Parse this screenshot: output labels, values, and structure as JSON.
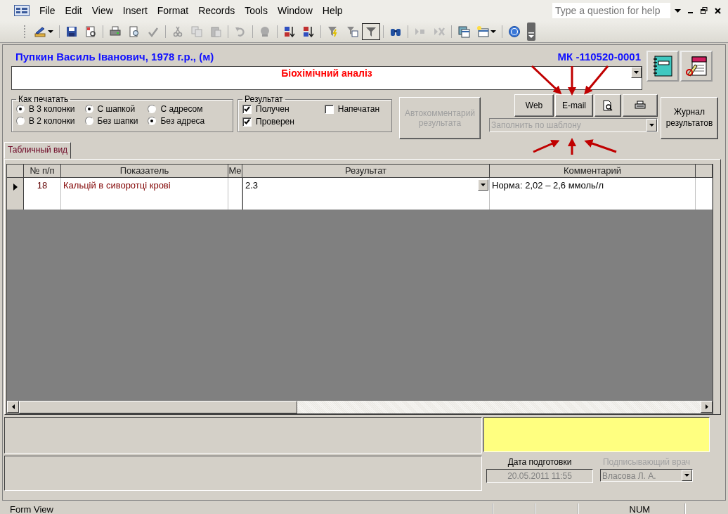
{
  "menubar": {
    "items": [
      "File",
      "Edit",
      "View",
      "Insert",
      "Format",
      "Records",
      "Tools",
      "Window",
      "Help"
    ],
    "help_search": {
      "placeholder": "Type a question for help"
    }
  },
  "form": {
    "patient": "Пупкин Василь Іванович, 1978 г.р., (м)",
    "record_id": "МК -110520-0001",
    "analysis": "Біохімічний аналіз",
    "print_options": {
      "title": "Как печатать",
      "groups": [
        {
          "options": [
            {
              "label": "В 3 колонки",
              "selected": true
            },
            {
              "label": "В 2 колонки",
              "selected": false
            }
          ]
        },
        {
          "options": [
            {
              "label": "С шапкой",
              "selected": true
            },
            {
              "label": "Без шапки",
              "selected": false
            }
          ]
        },
        {
          "options": [
            {
              "label": "С адресом",
              "selected": false
            },
            {
              "label": "Без адреса",
              "selected": true
            }
          ]
        }
      ]
    },
    "result_status": {
      "title": "Результат",
      "checkboxes": [
        {
          "label": "Получен",
          "checked": true
        },
        {
          "label": "Проверен",
          "checked": true
        },
        {
          "label": "Напечатан",
          "checked": false
        }
      ]
    },
    "autocomment_button": {
      "label": "Автокомментарий результата",
      "disabled": true
    },
    "send_buttons": [
      "Web",
      "E-mail"
    ],
    "template_combo": {
      "placeholder": "Заполнить по шаблону",
      "disabled": true
    },
    "journal_button": "Журнал результатов",
    "tabs": [
      {
        "label": "Табличный вид",
        "selected": true
      }
    ],
    "table": {
      "columns": [
        "№ п/п",
        "Показатель",
        "Ме",
        "Результат",
        "Комментарий"
      ],
      "rows": [
        {
          "current": true,
          "number": "18",
          "indicator": "Кальцій в сиворотці крові",
          "result": "2.3",
          "comment": "Норма: 2,02 – 2,6 ммоль/л"
        }
      ]
    },
    "preparation_date": {
      "label": "Дата подготовки",
      "value": "20.05.2011 11:55"
    },
    "signing_doctor": {
      "label": "Подписывающий врач",
      "value": "Власова Л. А.",
      "disabled": true
    }
  },
  "status_bar": {
    "mode": "Form View",
    "indicator": "NUM"
  }
}
